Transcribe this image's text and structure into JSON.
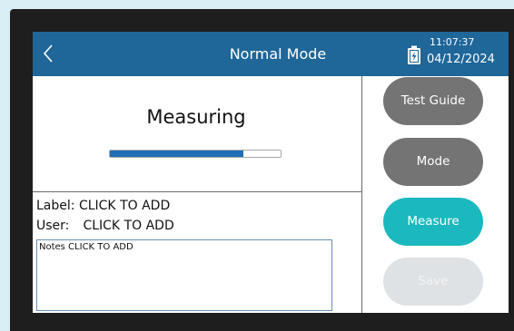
{
  "header": {
    "title": "Normal Mode",
    "time": "11:07:37",
    "date": "04/12/2024"
  },
  "status": {
    "text": "Measuring",
    "progress_fraction": 0.78,
    "progress_color": "#1f6fb3"
  },
  "info": {
    "label_key": "Label:",
    "label_value": "CLICK TO ADD",
    "user_key": "User:",
    "user_value": "CLICK TO ADD",
    "notes_placeholder": "Notes CLICK TO ADD"
  },
  "buttons": {
    "test_guide": "Test Guide",
    "mode": "Mode",
    "measure": "Measure",
    "save": "Save"
  },
  "colors": {
    "header_bg": "#1f6699",
    "measure_active": "#1bb9bf",
    "button_gray": "#747474",
    "button_disabled": "#dfe2e5"
  },
  "icons": {
    "back": "chevron-left-icon",
    "battery": "battery-charging-icon"
  }
}
